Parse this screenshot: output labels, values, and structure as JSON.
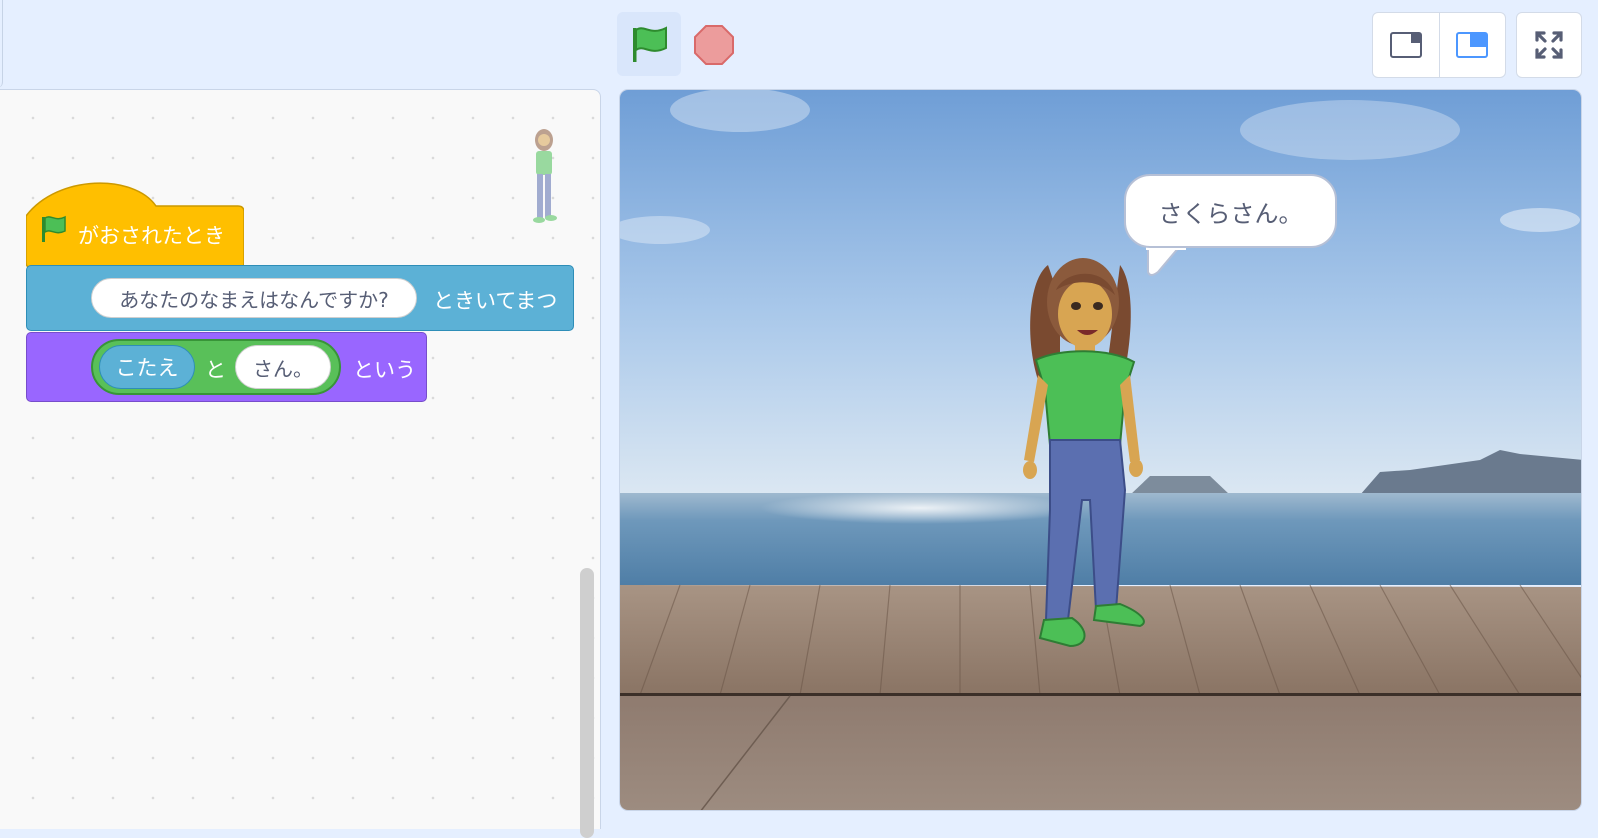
{
  "toolbar": {
    "green_flag_icon": "green-flag-icon",
    "stop_icon": "stop-sign-icon",
    "layout_modes": [
      "small-stage-icon",
      "normal-stage-icon"
    ],
    "fullscreen_icon": "fullscreen-icon"
  },
  "code": {
    "hat_block": {
      "label": "がおされたとき",
      "icon": "green-flag-icon",
      "color": "#ffbf00"
    },
    "ask_block": {
      "input": "あなたのなまえはなんですか?",
      "suffix": "ときいてまつ",
      "color": "#5cb1d6"
    },
    "say_block": {
      "join": {
        "answer": "こたえ",
        "and": "と",
        "input": "さん。"
      },
      "suffix": "という",
      "color": "#9966ff"
    }
  },
  "stage": {
    "speech": "さくらさん。"
  },
  "colors": {
    "accent": "#4c97ff",
    "event": "#ffbf00",
    "sensing": "#5cb1d6",
    "looks": "#9966ff",
    "operators": "#59c059"
  }
}
